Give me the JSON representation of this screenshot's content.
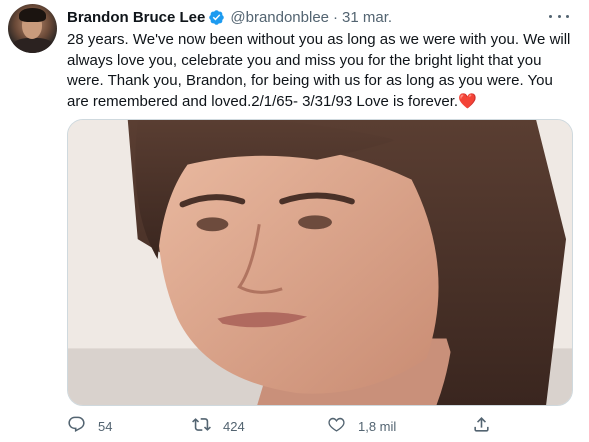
{
  "tweet": {
    "author_name": "Brandon Bruce Lee",
    "handle": "@brandonblee",
    "separator": "·",
    "date": "31 mar.",
    "text": "28 years. We've now been without you as long as we were with you. We will always love you, celebrate you and miss you for the bright light that you were. Thank you, Brandon, for being with us for as long as you were. You are remembered and loved.2/1/65- 3/31/93 Love is forever.",
    "emoji": "❤️"
  },
  "actions": {
    "replies": "54",
    "retweets": "424",
    "likes": "1,8 mil"
  },
  "icons": {
    "verified": "verified-badge-icon",
    "more": "more-options-icon",
    "reply": "reply-icon",
    "retweet": "retweet-icon",
    "like": "heart-icon",
    "share": "share-icon"
  },
  "colors": {
    "verified": "#1d9bf0",
    "text": "#0f1419",
    "muted": "#536471",
    "heart_emoji": "#e0245e"
  }
}
